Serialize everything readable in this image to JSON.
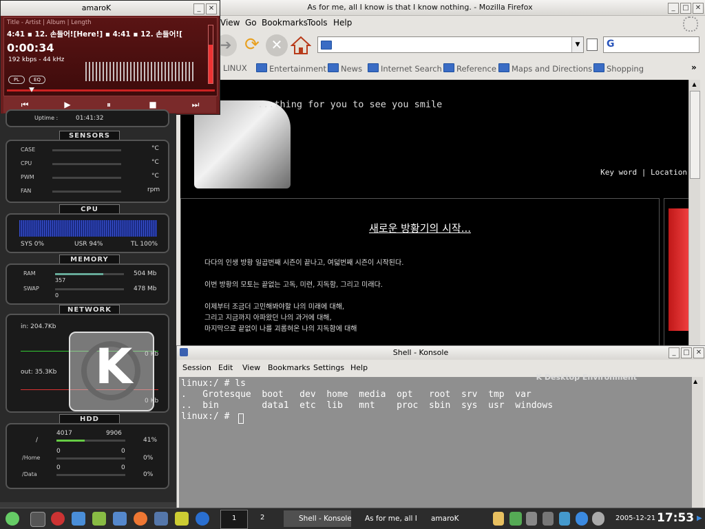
{
  "firefox": {
    "title": "As for me, all I know is that I know nothing. - Mozilla Firefox",
    "menu": [
      "View",
      "Go",
      "Bookmarks",
      "Tools",
      "Help"
    ],
    "url": "",
    "bookmarks": [
      "LINUX",
      "Entertainment",
      "News",
      "Internet Search",
      "Reference",
      "Maps and Directions",
      "Shopping"
    ],
    "page": {
      "header_text": "...thing for you to see you smile",
      "keyword_link": "Key word",
      "location_link": "Location",
      "post_title": "새로운 방황기의 시작...",
      "lines": [
        "다다의 인생 방황 일곱번째 시즌이 끝나고, 여덟번째 시즌이 시작된다.",
        "이번 방황의 모토는 끝없는 고독, 미련, 지독함, 그리고 미래다.",
        "이제부터 조금더 고민해봐야할 나의 미래에 대해,",
        "그리고 지금까지 아파왔던 나의 과거에 대해,",
        "마지막으로 끝없이 나를 괴롭혀온 나의 지독함에 대해"
      ]
    }
  },
  "amarok": {
    "title": "amaroK",
    "header": "Title - Artist | Album | Length",
    "ticker": "4:41  ▪  12. 손들어![Here!]  ▪  4:41  ▪  12. 손들어![",
    "time": "0:00:34",
    "bitrate": "192 kbps - 44 kHz",
    "pl_label": "PL",
    "eq_label": "EQ",
    "progress": 0.12
  },
  "karamba": {
    "uptime_label": "Uptime :",
    "uptime": "01:41:32",
    "sections": [
      "SENSORS",
      "CPU",
      "MEMORY",
      "NETWORK",
      "HDD"
    ],
    "sensors": [
      {
        "label": "CASE",
        "unit": "°C"
      },
      {
        "label": "CPU",
        "unit": "°C"
      },
      {
        "label": "PWM",
        "unit": "°C"
      },
      {
        "label": "FAN",
        "unit": "rpm"
      }
    ],
    "cpu": {
      "sys": "SYS 0%",
      "usr": "USR 94%",
      "tl": "TL 100%"
    },
    "memory": {
      "ram_label": "RAM",
      "ram_used": "357",
      "ram_total": "504 Mb",
      "swap_label": "SWAP",
      "swap_used": "0",
      "swap_total": "478 Mb"
    },
    "network": {
      "in": "in: 204.7Kb",
      "out": "out: 35.3Kb",
      "in_kb": "0 Kb",
      "out_kb": "0 Kb"
    },
    "hdd": [
      {
        "mount": "/",
        "used": "4017",
        "total": "9906",
        "pct": "41%"
      },
      {
        "mount": "/Home",
        "used": "0",
        "total": "0",
        "pct": "0%"
      },
      {
        "mount": "/Data",
        "used": "0",
        "total": "0",
        "pct": "0%"
      }
    ]
  },
  "konsole": {
    "title": "Shell - Konsole",
    "menu": [
      "Session",
      "Edit",
      "View",
      "Bookmarks",
      "Settings",
      "Help"
    ],
    "bg_text": "K Desktop Environment",
    "lines": [
      "linux:/ # ls",
      ".   Grotesque  boot   dev  home  media  opt   root  srv  tmp  var",
      "..  bin        data1  etc  lib   mnt    proc  sbin  sys  usr  windows",
      "linux:/ # "
    ]
  },
  "taskbar": {
    "desktops": [
      "1",
      "2"
    ],
    "tasks": [
      "Shell - Konsole",
      "As for me, all I k",
      "amaroK"
    ],
    "date": "2005-12-21",
    "time": "17:53"
  }
}
